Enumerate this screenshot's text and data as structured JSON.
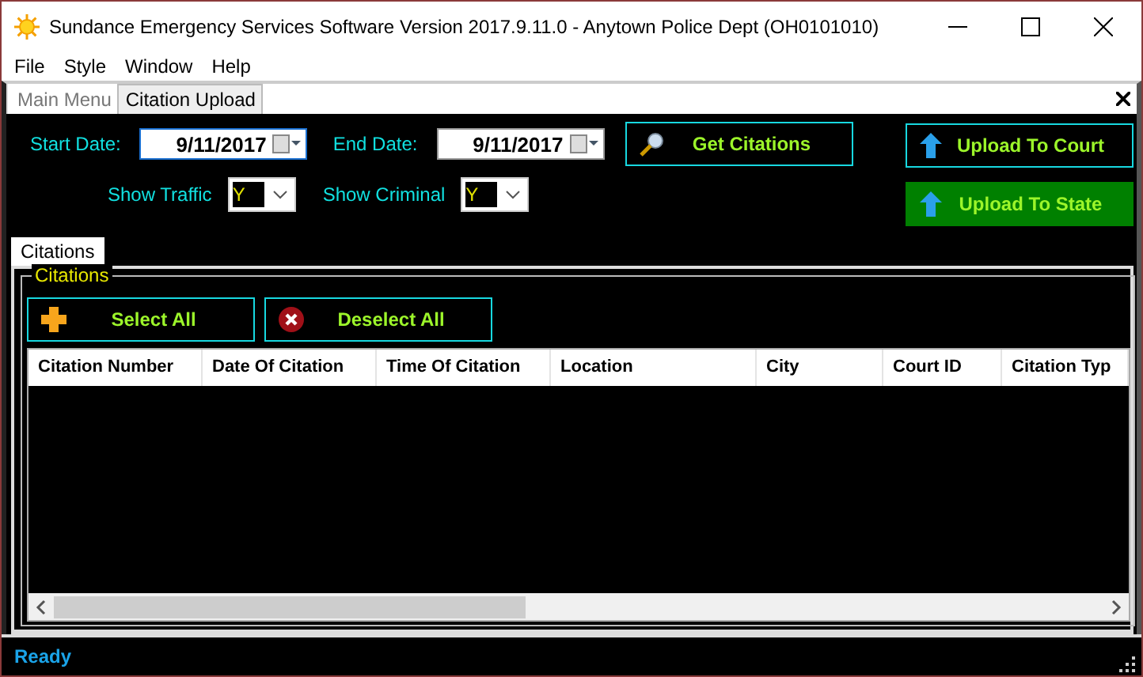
{
  "window": {
    "title": "Sundance Emergency Services Software Version 2017.9.11.0 - Anytown Police Dept (OH0101010)"
  },
  "menu": [
    "File",
    "Style",
    "Window",
    "Help"
  ],
  "doc_tabs": [
    {
      "label": "Main Menu",
      "selected": false
    },
    {
      "label": "Citation Upload",
      "selected": true
    }
  ],
  "filters": {
    "start_label": "Start Date:",
    "start_value": "9/11/2017",
    "end_label": "End Date:",
    "end_value": "9/11/2017",
    "traffic_label": "Show Traffic",
    "traffic_value": "Y",
    "criminal_label": "Show Criminal",
    "criminal_value": "Y"
  },
  "get_button": "Get Citations",
  "upload_buttons": [
    {
      "label": "Upload To Court",
      "kind": "outline"
    },
    {
      "label": "Upload To State",
      "kind": "filled"
    }
  ],
  "inner_tabs": [
    {
      "label": "Citations",
      "selected": true
    }
  ],
  "group_title": "Citations",
  "select_buttons": [
    {
      "label": "Select All",
      "kind": "plus"
    },
    {
      "label": "Deselect All",
      "kind": "cross"
    }
  ],
  "table": {
    "columns": [
      "Citation Number",
      "Date Of Citation",
      "Time Of Citation",
      "Location",
      "City",
      "Court ID",
      "Citation Typ"
    ]
  },
  "status_bar": "Ready"
}
